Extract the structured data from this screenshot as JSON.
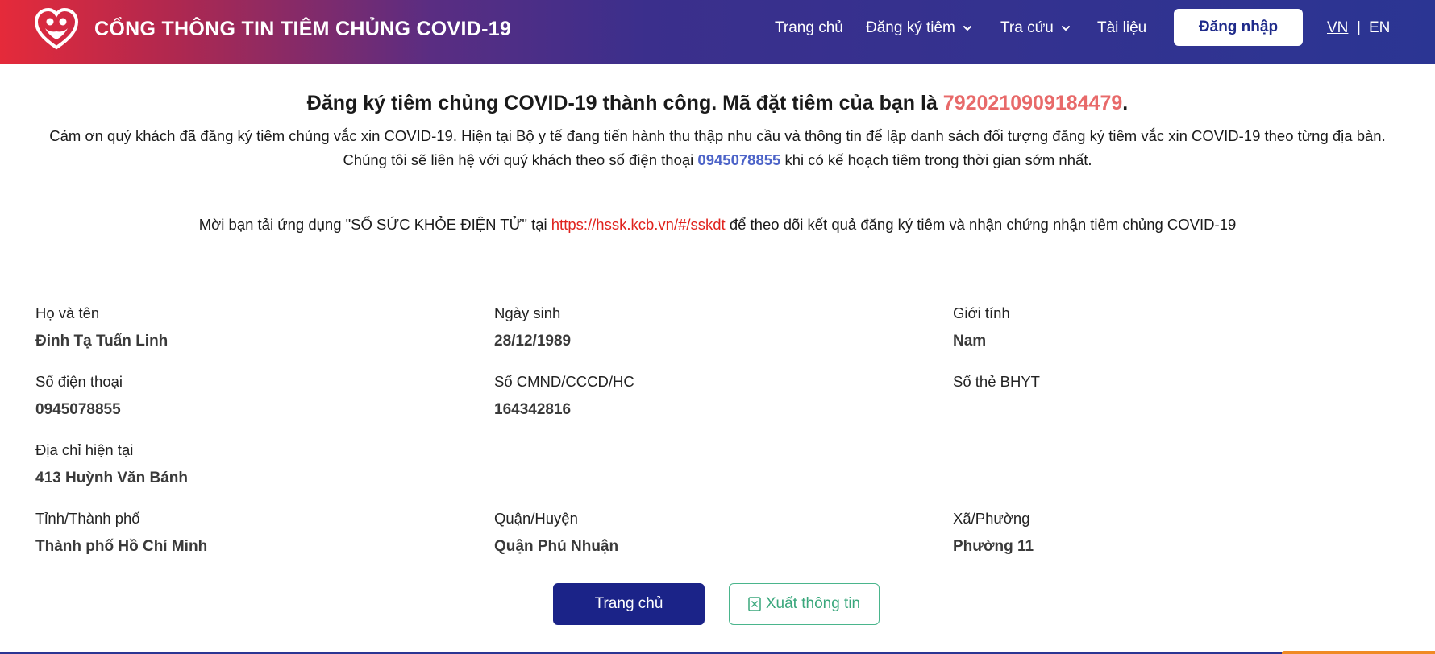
{
  "header": {
    "title": "CỔNG THÔNG TIN TIÊM CHỦNG COVID-19",
    "nav": {
      "home": "Trang chủ",
      "register": "Đăng ký tiêm",
      "lookup": "Tra cứu",
      "docs": "Tài liệu"
    },
    "login_label": "Đăng nhập",
    "lang_vn": "VN",
    "lang_sep": "|",
    "lang_en": "EN"
  },
  "message": {
    "title_prefix": "Đăng ký tiêm chủng COVID-19 thành công. Mã đặt tiêm của bạn là ",
    "booking_code": "7920210909184479",
    "title_suffix": ".",
    "line1": "Cảm ơn quý khách đã đăng ký tiêm chủng vắc xin COVID-19. Hiện tại Bộ y tế đang tiến hành thu thập nhu cầu và thông tin để lập danh sách đối tượng đăng ký tiêm vắc xin COVID-19 theo từng địa bàn.",
    "line2_prefix": "Chúng tôi sẽ liên hệ với quý khách theo số điện thoại ",
    "line2_phone": "0945078855",
    "line2_suffix": " khi có kế hoạch tiêm trong thời gian sớm nhất.",
    "app_prefix": "Mời bạn tải ứng dụng \"SỔ SỨC KHỎE ĐIỆN TỬ\" tại ",
    "app_link": "https://hssk.kcb.vn/#/sskdt",
    "app_suffix": " để theo dõi kết quả đăng ký tiêm và nhận chứng nhận tiêm chủng COVID-19"
  },
  "fields": {
    "name": {
      "label": "Họ và tên",
      "value": "Đinh Tạ Tuấn Linh"
    },
    "dob": {
      "label": "Ngày sinh",
      "value": "28/12/1989"
    },
    "gender": {
      "label": "Giới tính",
      "value": "Nam"
    },
    "phone": {
      "label": "Số điện thoại",
      "value": "0945078855"
    },
    "id_number": {
      "label": "Số CMND/CCCD/HC",
      "value": "164342816"
    },
    "insurance": {
      "label": "Số thẻ BHYT",
      "value": ""
    },
    "address": {
      "label": "Địa chỉ hiện tại",
      "value": "413 Huỳnh Văn Bánh"
    },
    "province": {
      "label": "Tỉnh/Thành phố",
      "value": "Thành phố Hồ Chí Minh"
    },
    "district": {
      "label": "Quận/Huyện",
      "value": "Quận Phú Nhuận"
    },
    "ward": {
      "label": "Xã/Phường",
      "value": "Phường 11"
    }
  },
  "actions": {
    "home_label": "Trang chủ",
    "export_label": "Xuất thông tin"
  },
  "colors": {
    "primary": "#1b2388",
    "booking_code": "#e86a6a",
    "phone_highlight": "#4c63c8",
    "link": "#e0221d",
    "export_green": "#3aa77c"
  },
  "icons": {
    "logo": "heart-people-logo-icon",
    "dropdown": "chevron-down-icon",
    "export": "excel-file-icon"
  }
}
